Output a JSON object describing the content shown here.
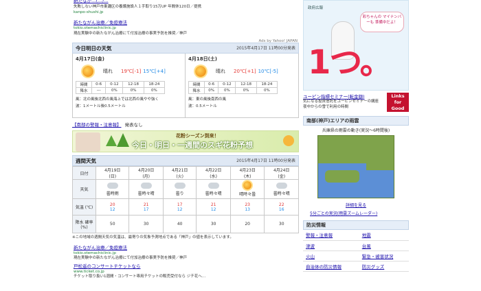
{
  "ads_top": {
    "line1_link": "新たなが…(…)…",
    "line1_desc": "失敗しない神戸市東灘区の養護施設人１手取り15万UP 年間休120日／提携",
    "line1_url": "kanpo-shushi.jp",
    "ad2_title": "新たながん治療／免疫療法",
    "ad2_url": "tokio.otemachiclinic.jp",
    "ad2_desc": "現在実験中の新たながん治療にて付加治療の事実予防を推奨／神戸",
    "ads_by": "Ads by Yahoo! JAPAN"
  },
  "today": {
    "header": "今日明日の天気",
    "stamp": "2015年4月17日 11時00分発表",
    "days": [
      {
        "date": "4月17日(金)",
        "weather": "晴れ",
        "hi": "19℃",
        "hi_diff": "[-1]",
        "lo": "15℃",
        "lo_diff": "[+4]",
        "times": [
          "時間",
          "0-6",
          "0-12",
          "12-18",
          "18-24"
        ],
        "rain": [
          "降水",
          "---",
          "0%",
          "0%",
          "0%"
        ],
        "wind": "風：北の風後北西の風海上では北西の風やや強く",
        "wave": "波：1メートル後0.5メートル"
      },
      {
        "date": "4月18日(土)",
        "weather": "晴れ",
        "hi": "20℃",
        "hi_diff": "[+1]",
        "lo": "10℃",
        "lo_diff": "[-5]",
        "times": [
          "時間",
          "0-6",
          "0-12",
          "12-18",
          "18-24"
        ],
        "rain": [
          "降水",
          "0%",
          "0%",
          "0%",
          "0%"
        ],
        "wind": "風：東の風後南西の風",
        "wave": "波：0.5メートル"
      }
    ]
  },
  "alert": {
    "label": "【南部の警報・注意報】",
    "value": "発表なし"
  },
  "pollen": {
    "top": "花粉シーズン到来！",
    "main": "今日・明日・一週間のスギ花粉予想"
  },
  "weekly": {
    "header": "週間天気",
    "stamp": "2015年4月17日 11時00分発表",
    "row_labels": [
      "日付",
      "天気",
      "気温 (℃)",
      "降水 確率 (%)"
    ],
    "days": [
      {
        "date": "4月19日",
        "dow": "(日)",
        "weather": "曇時雨",
        "hi": "20",
        "lo": "12",
        "rain": "50"
      },
      {
        "date": "4月20日",
        "dow": "(月)",
        "weather": "曇時々晴",
        "hi": "21",
        "lo": "17",
        "rain": "30"
      },
      {
        "date": "4月21日",
        "dow": "(火)",
        "weather": "曇り",
        "hi": "17",
        "lo": "12",
        "rain": "40"
      },
      {
        "date": "4月22日",
        "dow": "(水)",
        "weather": "曇時々晴",
        "hi": "21",
        "lo": "12",
        "rain": "30"
      },
      {
        "date": "4月23日",
        "dow": "(木)",
        "weather": "晴時々曇",
        "hi": "23",
        "lo": "13",
        "rain": "20"
      },
      {
        "date": "4月24日",
        "dow": "(金)",
        "weather": "曇時々晴",
        "hi": "22",
        "lo": "16",
        "rain": "30"
      }
    ],
    "note": "※この地域の週間天気の気温は、最寄りの気象予測地点である「神戸」の値を表示しています。"
  },
  "ads_bottom": {
    "a1_title": "新たながん治療／免疫療法",
    "a1_url": "tokio.otemachiclinic.jp",
    "a1_desc": "現在実験中の新たながん治療にて付加治療の事実予防を推奨／神戸",
    "a2_title": "戸松遥のコンサートチケットなら",
    "a2_url": "www.ticket.co.jp",
    "a2_desc": "チケット取り扱い1週間・コンサート専用チケットの販売受付なら ジチ花ヘ…"
  },
  "side": {
    "banner_small": "政府広報",
    "banner_bubble": "彩ちゃんの マイナンバーも 準備中だよ！",
    "banner_big": "1つ。",
    "ad_link": "ユーピン指標セミナー(転金額)",
    "ad_desc": "気になる投資信託をユーピンセミナーの講座 夜中からの雪で利用の時間",
    "ad_badge_1": "Links",
    "ad_badge_2": "for",
    "ad_badge_3": "Good",
    "region_header": "南部(神戸)エリアの雨雲",
    "map_caption": "兵庫県の雨雲の動き(実況〜6時間後)",
    "map_link": "詳細を見る",
    "map_link2": "5分ごとの実況(雨雲ズームレーダー)",
    "disaster_header": "防災情報",
    "disaster_items": [
      "警報・注意報",
      "地震",
      "津波",
      "台風",
      "火山",
      "緊急・被害状況",
      "自治体の防災情報",
      "防災グッズ"
    ]
  },
  "colors": {
    "accent": "#1a0dab",
    "header_bg": "#dfe8f4",
    "pollen_bg": "#e5f0b8",
    "hot": "#e53935",
    "cold": "#1e88e5"
  }
}
